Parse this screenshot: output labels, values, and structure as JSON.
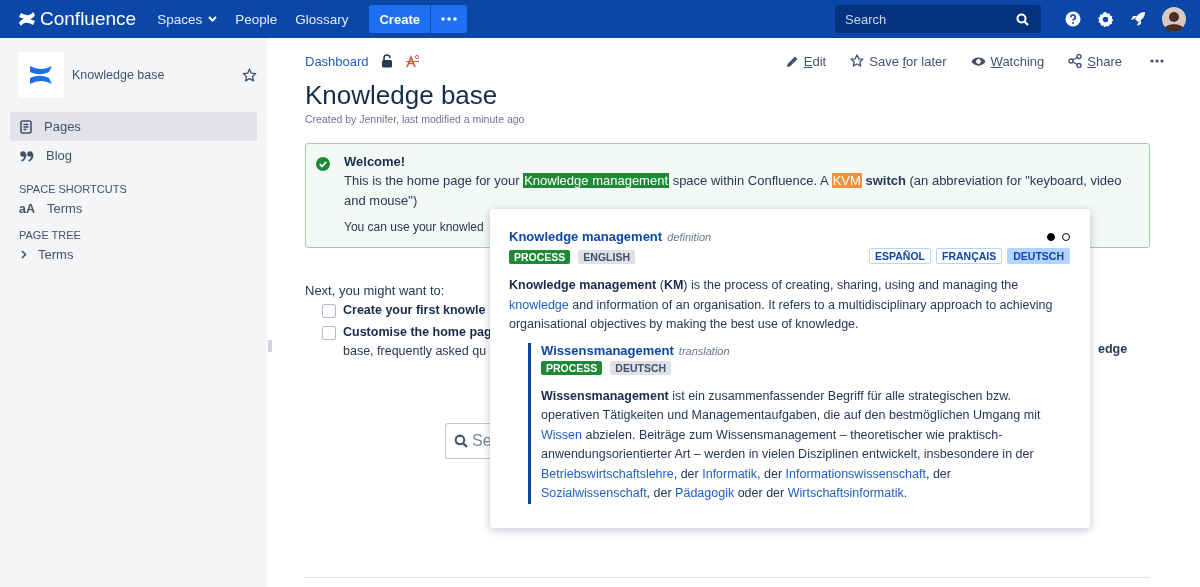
{
  "topbar": {
    "logo": "Confluence",
    "nav": [
      {
        "label": "Spaces",
        "dropdown": true
      },
      {
        "label": "People",
        "dropdown": false
      },
      {
        "label": "Glossary",
        "dropdown": false
      }
    ],
    "create": "Create",
    "search": {
      "placeholder": "Search"
    }
  },
  "sidebar": {
    "space_name": "Knowledge base",
    "items": [
      {
        "label": "Pages",
        "selected": true
      },
      {
        "label": "Blog",
        "selected": false
      }
    ],
    "shortcuts_heading": "SPACE SHORTCUTS",
    "shortcuts": [
      {
        "icon_text": "aA",
        "label": "Terms"
      }
    ],
    "tree_heading": "PAGE TREE",
    "tree": [
      {
        "label": "Terms",
        "expanded": false
      }
    ]
  },
  "page": {
    "breadcrumb": "Dashboard",
    "actions": [
      {
        "key": "E",
        "post": "dit"
      },
      {
        "pre": "Save ",
        "key": "f",
        "post": "or later"
      },
      {
        "key": "W",
        "post": "atching"
      },
      {
        "key": "S",
        "post": "hare"
      }
    ],
    "title": "Knowledge base",
    "byline": "Created by Jennifer, last modified a minute ago",
    "welcome": {
      "title": "Welcome!",
      "segments": [
        {
          "kind": "plain",
          "text": "This is the home page for your "
        },
        {
          "kind": "highlight",
          "text": "Knowledge management",
          "color": "#1e8a35"
        },
        {
          "kind": "plain",
          "text": " space within Confluence. A "
        },
        {
          "kind": "highlight",
          "text": "KVM",
          "color": "#f0903a"
        },
        {
          "kind": "bold",
          "text": " switch"
        },
        {
          "kind": "plain",
          "text": " (an abbreviation for \"keyboard, video and mouse\")"
        }
      ],
      "second": "You can use your knowled"
    },
    "next": "Next, you might want to:",
    "tasks": [
      {
        "text": "Create your first knowle",
        "checked": false
      },
      {
        "text": "Customise the home pag",
        "continuation": "base, frequently asked qu",
        "checked": false
      }
    ],
    "right_fragment": "edge",
    "search": {
      "placeholder": "Se"
    }
  },
  "popup": {
    "term": "Knowledge management",
    "type": "definition",
    "pager": [
      {
        "selected": true
      },
      {
        "selected": false
      }
    ],
    "tags": [
      {
        "label": "PROCESS",
        "kind": "category"
      },
      {
        "label": "ENGLISH",
        "kind": "language"
      }
    ],
    "languages": [
      {
        "label": "ESPAÑOL",
        "selected": false
      },
      {
        "label": "FRANÇAIS",
        "selected": false
      },
      {
        "label": "DEUTSCH",
        "selected": true
      }
    ],
    "body": [
      {
        "kind": "bold",
        "text": "Knowledge management"
      },
      {
        "kind": "plain",
        "text": " ("
      },
      {
        "kind": "bold",
        "text": "KM"
      },
      {
        "kind": "plain",
        "text": ") is the process of creating, sharing, using and managing the "
      },
      {
        "kind": "link",
        "text": "knowledge"
      },
      {
        "kind": "plain",
        "text": " and information of an organisation. It refers to a multidisciplinary approach to achieving organisational objectives by making the best use of knowledge."
      }
    ],
    "translation": {
      "term": "Wissensmanagement",
      "type": "translation",
      "tags": [
        {
          "label": "PROCESS",
          "kind": "category"
        },
        {
          "label": "DEUTSCH",
          "kind": "language"
        }
      ],
      "body": [
        {
          "kind": "bold",
          "text": "Wissensmanagement"
        },
        {
          "kind": "plain",
          "text": " ist ein zusammenfassender Begriff für alle strategischen bzw. operativen Tätigkeiten und Managementaufgaben, die auf den bestmöglichen Umgang mit "
        },
        {
          "kind": "link",
          "text": "Wissen"
        },
        {
          "kind": "plain",
          "text": " abzielen. Beiträge zum Wissensmanagement – theoretischer wie praktisch-anwendungsorientierter Art – werden in vielen Disziplinen entwickelt, insbesondere in der "
        },
        {
          "kind": "link",
          "text": "Betriebswirtschaftslehre"
        },
        {
          "kind": "plain",
          "text": ", der "
        },
        {
          "kind": "link",
          "text": "Informatik"
        },
        {
          "kind": "plain",
          "text": ", der "
        },
        {
          "kind": "link",
          "text": "Informationswissenschaft"
        },
        {
          "kind": "plain",
          "text": ", der "
        },
        {
          "kind": "link",
          "text": "Sozialwissenschaft"
        },
        {
          "kind": "plain",
          "text": ", der "
        },
        {
          "kind": "link",
          "text": "Pädagogik"
        },
        {
          "kind": "plain",
          "text": " oder der "
        },
        {
          "kind": "link",
          "text": "Wirtschaftsinformatik"
        },
        {
          "kind": "plain",
          "text": "."
        }
      ]
    }
  }
}
